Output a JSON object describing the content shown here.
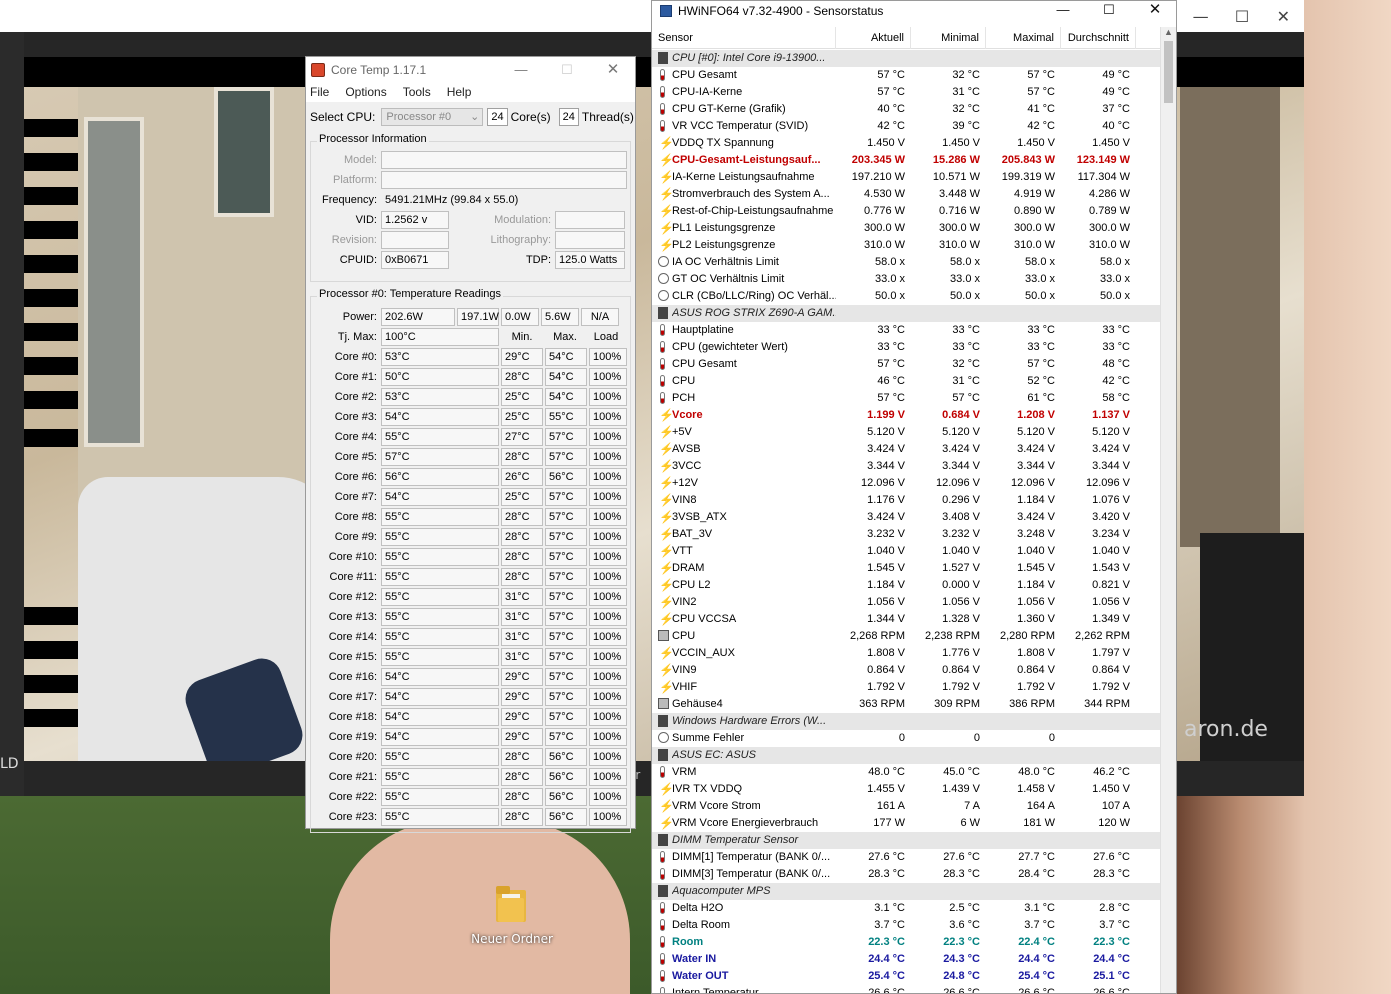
{
  "desktop": {
    "folder_label": "Neuer Ordner",
    "bg_left_text": "LD",
    "bg_mid_text": "er",
    "watermark": "aron.de",
    "bg_win_controls": [
      "—",
      "☐",
      "✕"
    ]
  },
  "coretemp": {
    "title": "Core Temp 1.17.1",
    "menu": [
      "File",
      "Options",
      "Tools",
      "Help"
    ],
    "select_cpu_label": "Select CPU:",
    "select_cpu_value": "Processor #0",
    "cores_count": "24",
    "cores_label": "Core(s)",
    "threads_count": "24",
    "threads_label": "Thread(s)",
    "proc_info_title": "Processor Information",
    "model_label": "Model:",
    "model_value": "",
    "platform_label": "Platform:",
    "platform_value": "",
    "frequency_label": "Frequency:",
    "frequency_value": "5491.21MHz (99.84 x 55.0)",
    "vid_label": "VID:",
    "vid_value": "1.2562 v",
    "modulation_label": "Modulation:",
    "modulation_value": "",
    "revision_label": "Revision:",
    "revision_value": "",
    "lithography_label": "Lithography:",
    "lithography_value": "",
    "cpuid_label": "CPUID:",
    "cpuid_value": "0xB0671",
    "tdp_label": "TDP:",
    "tdp_value": "125.0 Watts",
    "temp_title": "Processor #0: Temperature Readings",
    "power_label": "Power:",
    "power_values": [
      "202.6W",
      "197.1W",
      "0.0W",
      "5.6W",
      "N/A"
    ],
    "tjmax_label": "Tj. Max:",
    "tjmax_value": "100°C",
    "col_min": "Min.",
    "col_max": "Max.",
    "col_load": "Load",
    "cores": [
      {
        "label": "Core #0:",
        "temp": "53°C",
        "min": "29°C",
        "max": "54°C",
        "load": "100%"
      },
      {
        "label": "Core #1:",
        "temp": "50°C",
        "min": "28°C",
        "max": "54°C",
        "load": "100%"
      },
      {
        "label": "Core #2:",
        "temp": "53°C",
        "min": "25°C",
        "max": "54°C",
        "load": "100%"
      },
      {
        "label": "Core #3:",
        "temp": "54°C",
        "min": "25°C",
        "max": "55°C",
        "load": "100%"
      },
      {
        "label": "Core #4:",
        "temp": "55°C",
        "min": "27°C",
        "max": "57°C",
        "load": "100%"
      },
      {
        "label": "Core #5:",
        "temp": "57°C",
        "min": "28°C",
        "max": "57°C",
        "load": "100%"
      },
      {
        "label": "Core #6:",
        "temp": "56°C",
        "min": "26°C",
        "max": "56°C",
        "load": "100%"
      },
      {
        "label": "Core #7:",
        "temp": "54°C",
        "min": "25°C",
        "max": "57°C",
        "load": "100%"
      },
      {
        "label": "Core #8:",
        "temp": "55°C",
        "min": "28°C",
        "max": "57°C",
        "load": "100%"
      },
      {
        "label": "Core #9:",
        "temp": "55°C",
        "min": "28°C",
        "max": "57°C",
        "load": "100%"
      },
      {
        "label": "Core #10:",
        "temp": "55°C",
        "min": "28°C",
        "max": "57°C",
        "load": "100%"
      },
      {
        "label": "Core #11:",
        "temp": "55°C",
        "min": "28°C",
        "max": "57°C",
        "load": "100%"
      },
      {
        "label": "Core #12:",
        "temp": "55°C",
        "min": "31°C",
        "max": "57°C",
        "load": "100%"
      },
      {
        "label": "Core #13:",
        "temp": "55°C",
        "min": "31°C",
        "max": "57°C",
        "load": "100%"
      },
      {
        "label": "Core #14:",
        "temp": "55°C",
        "min": "31°C",
        "max": "57°C",
        "load": "100%"
      },
      {
        "label": "Core #15:",
        "temp": "55°C",
        "min": "31°C",
        "max": "57°C",
        "load": "100%"
      },
      {
        "label": "Core #16:",
        "temp": "54°C",
        "min": "29°C",
        "max": "57°C",
        "load": "100%"
      },
      {
        "label": "Core #17:",
        "temp": "54°C",
        "min": "29°C",
        "max": "57°C",
        "load": "100%"
      },
      {
        "label": "Core #18:",
        "temp": "54°C",
        "min": "29°C",
        "max": "57°C",
        "load": "100%"
      },
      {
        "label": "Core #19:",
        "temp": "54°C",
        "min": "29°C",
        "max": "57°C",
        "load": "100%"
      },
      {
        "label": "Core #20:",
        "temp": "55°C",
        "min": "28°C",
        "max": "56°C",
        "load": "100%"
      },
      {
        "label": "Core #21:",
        "temp": "55°C",
        "min": "28°C",
        "max": "56°C",
        "load": "100%"
      },
      {
        "label": "Core #22:",
        "temp": "55°C",
        "min": "28°C",
        "max": "56°C",
        "load": "100%"
      },
      {
        "label": "Core #23:",
        "temp": "55°C",
        "min": "28°C",
        "max": "56°C",
        "load": "100%"
      }
    ]
  },
  "hwinfo": {
    "title": "HWiNFO64 v7.32-4900 - Sensorstatus",
    "headers": [
      "Sensor",
      "Aktuell",
      "Minimal",
      "Maximal",
      "Durchschnitt"
    ],
    "rows": [
      {
        "type": "group",
        "icon": "chip",
        "name": "CPU [#0]: Intel Core i9-13900...",
        "v": [
          "",
          "",
          "",
          ""
        ]
      },
      {
        "type": "sensor",
        "icon": "therm",
        "name": "CPU Gesamt",
        "v": [
          "57 °C",
          "32 °C",
          "57 °C",
          "49 °C"
        ]
      },
      {
        "type": "sensor",
        "icon": "therm",
        "name": "CPU-IA-Kerne",
        "v": [
          "57 °C",
          "31 °C",
          "57 °C",
          "49 °C"
        ]
      },
      {
        "type": "sensor",
        "icon": "therm",
        "name": "CPU GT-Kerne (Grafik)",
        "v": [
          "40 °C",
          "32 °C",
          "41 °C",
          "37 °C"
        ]
      },
      {
        "type": "sensor",
        "icon": "therm",
        "name": "VR VCC Temperatur (SVID)",
        "v": [
          "42 °C",
          "39 °C",
          "42 °C",
          "40 °C"
        ]
      },
      {
        "type": "sensor",
        "icon": "volt",
        "name": "VDDQ TX Spannung",
        "v": [
          "1.450 V",
          "1.450 V",
          "1.450 V",
          "1.450 V"
        ]
      },
      {
        "type": "sensor",
        "icon": "volt",
        "style": "red",
        "name": "CPU-Gesamt-Leistungsauf...",
        "v": [
          "203.345 W",
          "15.286 W",
          "205.843 W",
          "123.149 W"
        ]
      },
      {
        "type": "sensor",
        "icon": "volt",
        "name": "IA-Kerne Leistungsaufnahme",
        "v": [
          "197.210 W",
          "10.571 W",
          "199.319 W",
          "117.304 W"
        ]
      },
      {
        "type": "sensor",
        "icon": "volt",
        "name": "Stromverbrauch des System A...",
        "v": [
          "4.530 W",
          "3.448 W",
          "4.919 W",
          "4.286 W"
        ]
      },
      {
        "type": "sensor",
        "icon": "volt",
        "name": "Rest-of-Chip-Leistungsaufnahme",
        "v": [
          "0.776 W",
          "0.716 W",
          "0.890 W",
          "0.789 W"
        ]
      },
      {
        "type": "sensor",
        "icon": "volt",
        "name": "PL1 Leistungsgrenze",
        "v": [
          "300.0 W",
          "300.0 W",
          "300.0 W",
          "300.0 W"
        ]
      },
      {
        "type": "sensor",
        "icon": "volt",
        "name": "PL2 Leistungsgrenze",
        "v": [
          "310.0 W",
          "310.0 W",
          "310.0 W",
          "310.0 W"
        ]
      },
      {
        "type": "sensor",
        "icon": "clock",
        "name": "IA OC Verhältnis Limit",
        "v": [
          "58.0 x",
          "58.0 x",
          "58.0 x",
          "58.0 x"
        ]
      },
      {
        "type": "sensor",
        "icon": "clock",
        "name": "GT OC Verhältnis Limit",
        "v": [
          "33.0 x",
          "33.0 x",
          "33.0 x",
          "33.0 x"
        ]
      },
      {
        "type": "sensor",
        "icon": "clock",
        "name": "CLR (CBo/LLC/Ring) OC Verhäl...",
        "v": [
          "50.0 x",
          "50.0 x",
          "50.0 x",
          "50.0 x"
        ]
      },
      {
        "type": "group",
        "icon": "chip",
        "name": "ASUS ROG STRIX Z690-A GAM...",
        "v": [
          "",
          "",
          "",
          ""
        ]
      },
      {
        "type": "sensor",
        "icon": "therm",
        "name": "Hauptplatine",
        "v": [
          "33 °C",
          "33 °C",
          "33 °C",
          "33 °C"
        ]
      },
      {
        "type": "sensor",
        "icon": "therm",
        "name": "CPU (gewichteter Wert)",
        "v": [
          "33 °C",
          "33 °C",
          "33 °C",
          "33 °C"
        ]
      },
      {
        "type": "sensor",
        "icon": "therm",
        "name": "CPU Gesamt",
        "v": [
          "57 °C",
          "32 °C",
          "57 °C",
          "48 °C"
        ]
      },
      {
        "type": "sensor",
        "icon": "therm",
        "name": "CPU",
        "v": [
          "46 °C",
          "31 °C",
          "52 °C",
          "42 °C"
        ]
      },
      {
        "type": "sensor",
        "icon": "therm",
        "name": "PCH",
        "v": [
          "57 °C",
          "57 °C",
          "61 °C",
          "58 °C"
        ]
      },
      {
        "type": "sensor",
        "icon": "volt",
        "style": "red",
        "name": "Vcore",
        "v": [
          "1.199 V",
          "0.684 V",
          "1.208 V",
          "1.137 V"
        ]
      },
      {
        "type": "sensor",
        "icon": "volt",
        "name": "+5V",
        "v": [
          "5.120 V",
          "5.120 V",
          "5.120 V",
          "5.120 V"
        ]
      },
      {
        "type": "sensor",
        "icon": "volt",
        "name": "AVSB",
        "v": [
          "3.424 V",
          "3.424 V",
          "3.424 V",
          "3.424 V"
        ]
      },
      {
        "type": "sensor",
        "icon": "volt",
        "name": "3VCC",
        "v": [
          "3.344 V",
          "3.344 V",
          "3.344 V",
          "3.344 V"
        ]
      },
      {
        "type": "sensor",
        "icon": "volt",
        "name": "+12V",
        "v": [
          "12.096 V",
          "12.096 V",
          "12.096 V",
          "12.096 V"
        ]
      },
      {
        "type": "sensor",
        "icon": "volt",
        "name": "VIN8",
        "v": [
          "1.176 V",
          "0.296 V",
          "1.184 V",
          "1.076 V"
        ]
      },
      {
        "type": "sensor",
        "icon": "volt",
        "name": "3VSB_ATX",
        "v": [
          "3.424 V",
          "3.408 V",
          "3.424 V",
          "3.420 V"
        ]
      },
      {
        "type": "sensor",
        "icon": "volt",
        "name": "BAT_3V",
        "v": [
          "3.232 V",
          "3.232 V",
          "3.248 V",
          "3.234 V"
        ]
      },
      {
        "type": "sensor",
        "icon": "volt",
        "name": "VTT",
        "v": [
          "1.040 V",
          "1.040 V",
          "1.040 V",
          "1.040 V"
        ]
      },
      {
        "type": "sensor",
        "icon": "volt",
        "name": "DRAM",
        "v": [
          "1.545 V",
          "1.527 V",
          "1.545 V",
          "1.543 V"
        ]
      },
      {
        "type": "sensor",
        "icon": "volt",
        "name": "CPU L2",
        "v": [
          "1.184 V",
          "0.000 V",
          "1.184 V",
          "0.821 V"
        ]
      },
      {
        "type": "sensor",
        "icon": "volt",
        "name": "VIN2",
        "v": [
          "1.056 V",
          "1.056 V",
          "1.056 V",
          "1.056 V"
        ]
      },
      {
        "type": "sensor",
        "icon": "volt",
        "name": "CPU VCCSA",
        "v": [
          "1.344 V",
          "1.328 V",
          "1.360 V",
          "1.349 V"
        ]
      },
      {
        "type": "sensor",
        "icon": "fan",
        "name": "CPU",
        "v": [
          "2,268 RPM",
          "2,238 RPM",
          "2,280 RPM",
          "2,262 RPM"
        ]
      },
      {
        "type": "sensor",
        "icon": "volt",
        "name": "VCCIN_AUX",
        "v": [
          "1.808 V",
          "1.776 V",
          "1.808 V",
          "1.797 V"
        ]
      },
      {
        "type": "sensor",
        "icon": "volt",
        "name": "VIN9",
        "v": [
          "0.864 V",
          "0.864 V",
          "0.864 V",
          "0.864 V"
        ]
      },
      {
        "type": "sensor",
        "icon": "volt",
        "name": "VHIF",
        "v": [
          "1.792 V",
          "1.792 V",
          "1.792 V",
          "1.792 V"
        ]
      },
      {
        "type": "sensor",
        "icon": "fan",
        "name": "Gehäuse4",
        "v": [
          "363 RPM",
          "309 RPM",
          "386 RPM",
          "344 RPM"
        ]
      },
      {
        "type": "group",
        "icon": "chip",
        "name": "Windows Hardware Errors (W...",
        "v": [
          "",
          "",
          "",
          ""
        ]
      },
      {
        "type": "sensor",
        "icon": "clock",
        "name": "Summe Fehler",
        "v": [
          "0",
          "0",
          "0",
          ""
        ]
      },
      {
        "type": "group",
        "icon": "chip",
        "name": "ASUS EC: ASUS",
        "v": [
          "",
          "",
          "",
          ""
        ]
      },
      {
        "type": "sensor",
        "icon": "therm",
        "name": "VRM",
        "v": [
          "48.0 °C",
          "45.0 °C",
          "48.0 °C",
          "46.2 °C"
        ]
      },
      {
        "type": "sensor",
        "icon": "volt",
        "name": "IVR TX VDDQ",
        "v": [
          "1.455 V",
          "1.439 V",
          "1.458 V",
          "1.450 V"
        ]
      },
      {
        "type": "sensor",
        "icon": "volt",
        "name": "VRM Vcore Strom",
        "v": [
          "161 A",
          "7 A",
          "164 A",
          "107 A"
        ]
      },
      {
        "type": "sensor",
        "icon": "volt",
        "name": "VRM Vcore Energieverbrauch",
        "v": [
          "177 W",
          "6 W",
          "181 W",
          "120 W"
        ]
      },
      {
        "type": "group",
        "icon": "chip",
        "name": "DIMM Temperatur Sensor",
        "v": [
          "",
          "",
          "",
          ""
        ]
      },
      {
        "type": "sensor",
        "icon": "therm",
        "name": "DIMM[1] Temperatur (BANK 0/...",
        "v": [
          "27.6 °C",
          "27.6 °C",
          "27.7 °C",
          "27.6 °C"
        ]
      },
      {
        "type": "sensor",
        "icon": "therm",
        "name": "DIMM[3] Temperatur (BANK 0/...",
        "v": [
          "28.3 °C",
          "28.3 °C",
          "28.4 °C",
          "28.3 °C"
        ]
      },
      {
        "type": "group",
        "icon": "chip",
        "name": "Aquacomputer MPS",
        "v": [
          "",
          "",
          "",
          ""
        ]
      },
      {
        "type": "sensor",
        "icon": "therm",
        "name": "Delta H2O",
        "v": [
          "3.1 °C",
          "2.5 °C",
          "3.1 °C",
          "2.8 °C"
        ]
      },
      {
        "type": "sensor",
        "icon": "therm",
        "name": "Delta Room",
        "v": [
          "3.7 °C",
          "3.6 °C",
          "3.7 °C",
          "3.7 °C"
        ]
      },
      {
        "type": "sensor",
        "icon": "therm",
        "style": "teal",
        "name": "Room",
        "v": [
          "22.3 °C",
          "22.3 °C",
          "22.4 °C",
          "22.3 °C"
        ]
      },
      {
        "type": "sensor",
        "icon": "therm",
        "style": "blue",
        "name": "Water IN",
        "v": [
          "24.4 °C",
          "24.3 °C",
          "24.4 °C",
          "24.4 °C"
        ]
      },
      {
        "type": "sensor",
        "icon": "therm",
        "style": "blue",
        "name": "Water OUT",
        "v": [
          "25.4 °C",
          "24.8 °C",
          "25.4 °C",
          "25.1 °C"
        ]
      },
      {
        "type": "sensor",
        "icon": "therm",
        "name": "Intern Temperatur",
        "v": [
          "26.6 °C",
          "26.6 °C",
          "26.6 °C",
          "26.6 °C"
        ]
      }
    ]
  }
}
